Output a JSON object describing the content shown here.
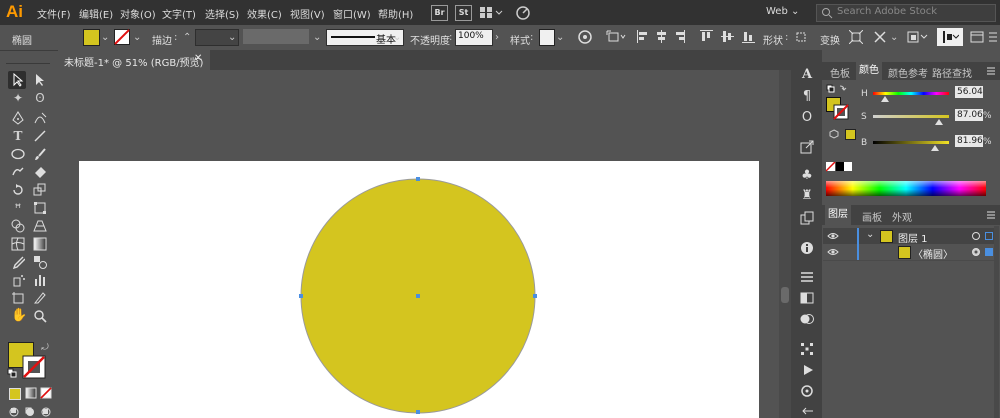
{
  "app": {
    "logo": "Ai"
  },
  "menu": [
    "文件(F)",
    "编辑(E)",
    "对象(O)",
    "文字(T)",
    "选择(S)",
    "效果(C)",
    "视图(V)",
    "窗口(W)",
    "帮助(H)"
  ],
  "menu_icons": {
    "bridge": "Br",
    "stock": "St"
  },
  "workspace": {
    "label": "Web",
    "chevron": "⌄"
  },
  "search": {
    "placeholder": "Search Adobe Stock"
  },
  "control": {
    "object_type": "椭圆",
    "stroke_label": "描边",
    "stroke_weight_arrow": "⌃",
    "brush_label": "基本",
    "opacity_label": "不透明度",
    "opacity_value": "100%",
    "style_label": "样式",
    "shape_label": "形状",
    "transform_label": "变换"
  },
  "document_tab": {
    "title": "未标题-1* @ 51% (RGB/预览)",
    "close": "✕"
  },
  "colors": {
    "fill": "#d4c51f",
    "accent": "#4a8fe0",
    "artboard": "#ffffff",
    "panel": "#535353",
    "dark": "#323232"
  },
  "color_panel": {
    "tabs": [
      "色板",
      "颜色",
      "颜色参考",
      "路径查找"
    ],
    "active_tab": "颜色",
    "sliders": [
      {
        "label": "H",
        "value": "56.04",
        "unit": "",
        "fraction": 0.16
      },
      {
        "label": "S",
        "value": "87.06",
        "unit": "%",
        "fraction": 0.87
      },
      {
        "label": "B",
        "value": "81.96",
        "unit": "%",
        "fraction": 0.82
      }
    ]
  },
  "layers_panel": {
    "tabs": [
      "图层",
      "画板",
      "外观"
    ],
    "active_tab": "图层",
    "rows": [
      {
        "name": "图层 1"
      },
      {
        "name": "〈椭圆〉"
      }
    ]
  },
  "canvas": {
    "shape": "ellipse",
    "fill": "#d4c51f",
    "stroke": "#9a9a9a"
  }
}
